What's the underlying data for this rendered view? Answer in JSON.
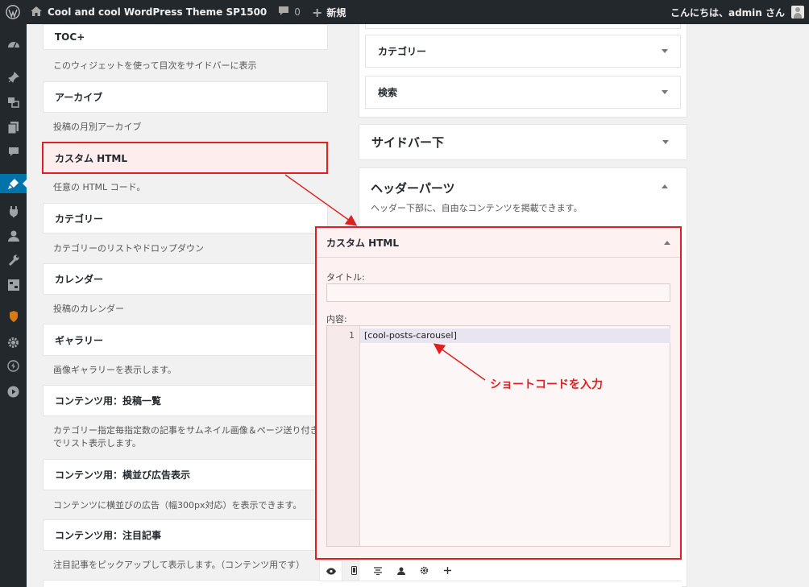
{
  "adminbar": {
    "site_name": "Cool and cool WordPress Theme SP1500",
    "comments_count": "0",
    "new_label": "新規",
    "greeting": "こんにちは、admin さん"
  },
  "admin_menu": [
    "dashboard-icon",
    "pin-icon",
    "media-icon",
    "pages-icon",
    "comments-icon",
    "appearance-icon",
    "plugins-icon",
    "users-icon",
    "tools-icon",
    "settings-icon",
    "shield-icon",
    "gear-icon",
    "bolt-icon",
    "play-icon"
  ],
  "available_widgets": [
    {
      "title": "TOC+",
      "desc": "このウィジェットを使って目次をサイドバーに表示"
    },
    {
      "title": "アーカイブ",
      "desc": "投稿の月別アーカイブ"
    },
    {
      "title": "カスタム HTML",
      "desc": "任意の HTML コード。"
    },
    {
      "title": "カテゴリー",
      "desc": "カテゴリーのリストやドロップダウン"
    },
    {
      "title": "カレンダー",
      "desc": "投稿のカレンダー"
    },
    {
      "title": "ギャラリー",
      "desc": "画像ギャラリーを表示します。"
    },
    {
      "title": "コンテンツ用：投稿一覧",
      "desc": "カテゴリー指定毎指定数の記事をサムネイル画像＆ページ送り付き",
      "desc2": "でリスト表示します。"
    },
    {
      "title": "コンテンツ用：横並び広告表示",
      "desc": "コンテンツに横並びの広告（幅300px対応）を表示できます。"
    },
    {
      "title": "コンテンツ用：注目記事",
      "desc": "注目記事をピックアップして表示します。（コンテンツ用です）"
    }
  ],
  "sidebar_widgets": {
    "category": "カテゴリー",
    "search": "検索"
  },
  "areas": {
    "sidebar_bottom": "サイドバー下",
    "header_parts": "ヘッダーパーツ",
    "header_parts_desc": "ヘッダー下部に、自由なコンテンツを掲載できます。"
  },
  "custom_html_widget": {
    "title": "カスタム HTML",
    "title_label": "タイトル:",
    "title_value": "",
    "content_label": "内容:",
    "line_number": "1",
    "code": "[cool-posts-carousel]"
  },
  "annotation": "ショートコードを入力",
  "tabs": [
    "eye-icon",
    "mobile-icon",
    "align-icon",
    "user-icon",
    "gear-icon",
    "plus-icon"
  ],
  "accent_color": "#e02020"
}
